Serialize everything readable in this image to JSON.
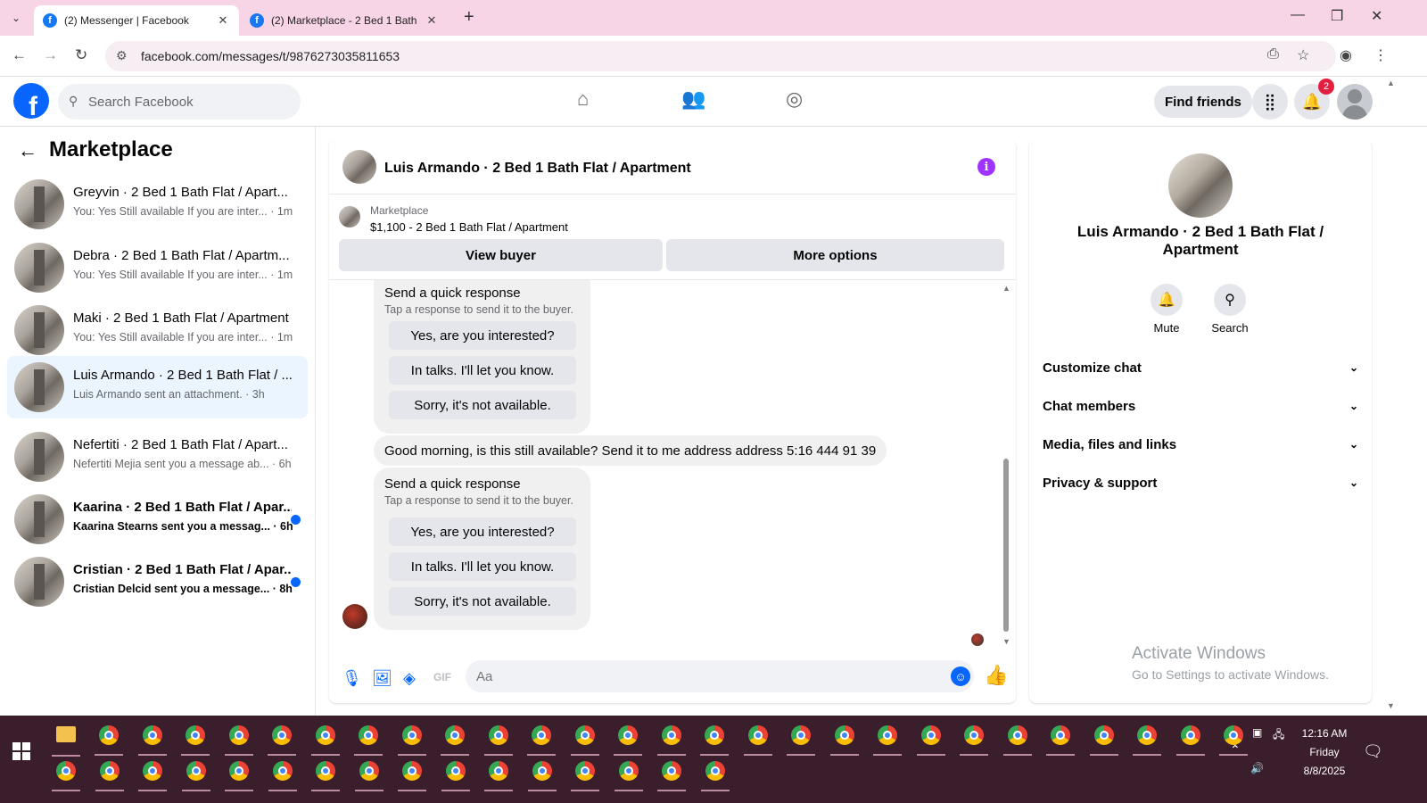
{
  "browser": {
    "tabs": [
      {
        "title": "(2) Messenger | Facebook",
        "active": true
      },
      {
        "title": "(2) Marketplace - 2 Bed 1 Bath F",
        "active": false
      }
    ],
    "url": "facebook.com/messages/t/9876273035811653"
  },
  "header": {
    "search_placeholder": "Search Facebook",
    "find_friends": "Find friends",
    "notification_count": "2"
  },
  "sidebar": {
    "title": "Marketplace",
    "conversations": [
      {
        "title": "Greyvin · 2 Bed 1 Bath Flat / Apart...",
        "preview": "You: Yes Still available If you are inter... · 1m",
        "unread": false,
        "selected": false
      },
      {
        "title": "Debra · 2 Bed 1 Bath Flat / Apartm...",
        "preview": "You: Yes Still available If you are inter... · 1m",
        "unread": false,
        "selected": false
      },
      {
        "title": "Maki · 2 Bed 1 Bath Flat / Apartment",
        "preview": "You: Yes Still available If you are inter... · 1m",
        "unread": false,
        "selected": false
      },
      {
        "title": "Luis Armando · 2 Bed 1 Bath Flat / ...",
        "preview": "Luis Armando sent an attachment. · 3h",
        "unread": false,
        "selected": true
      },
      {
        "title": "Nefertiti · 2 Bed 1 Bath Flat / Apart...",
        "preview": "Nefertiti Mejia sent you a message ab... · 6h",
        "unread": false,
        "selected": false
      },
      {
        "title": "Kaarina · 2 Bed 1 Bath Flat / Apar...",
        "preview": "Kaarina Stearns sent you a messag... · 6h",
        "unread": true,
        "selected": false
      },
      {
        "title": "Cristian · 2 Bed 1 Bath Flat / Apar...",
        "preview": "Cristian Delcid sent you a message... · 8h",
        "unread": true,
        "selected": false
      }
    ]
  },
  "chat": {
    "title": "Luis Armando · 2 Bed 1 Bath Flat / Apartment",
    "listing_label": "Marketplace",
    "listing_price": "$1,100 - 2 Bed 1 Bath Flat / Apartment",
    "view_buyer": "View buyer",
    "more_options": "More options",
    "quick_response_title": "Send a quick response",
    "quick_response_sub": "Tap a response to send it to the buyer.",
    "quick_options": [
      "Yes, are you interested?",
      "In talks. I'll let you know.",
      "Sorry, it's not available."
    ],
    "buyer_message": "Good morning, is this still available? Send it to me address address 5:16 444 91 39",
    "input_placeholder": "Aa"
  },
  "info_panel": {
    "title": "Luis Armando · 2 Bed 1 Bath Flat / Apartment",
    "mute": "Mute",
    "search": "Search",
    "sections": [
      "Customize chat",
      "Chat members",
      "Media, files and links",
      "Privacy & support"
    ]
  },
  "watermark": {
    "line1": "Activate Windows",
    "line2": "Go to Settings to activate Windows."
  },
  "taskbar": {
    "time": "12:16 AM",
    "day": "Friday",
    "date": "8/8/2025"
  },
  "colors": {
    "accent": "#0866ff",
    "tabbar": "#f7d4e6",
    "taskbar": "#3a1e2c",
    "selected_conversation": "#ebf5ff",
    "info_icon": "#a033ff"
  }
}
